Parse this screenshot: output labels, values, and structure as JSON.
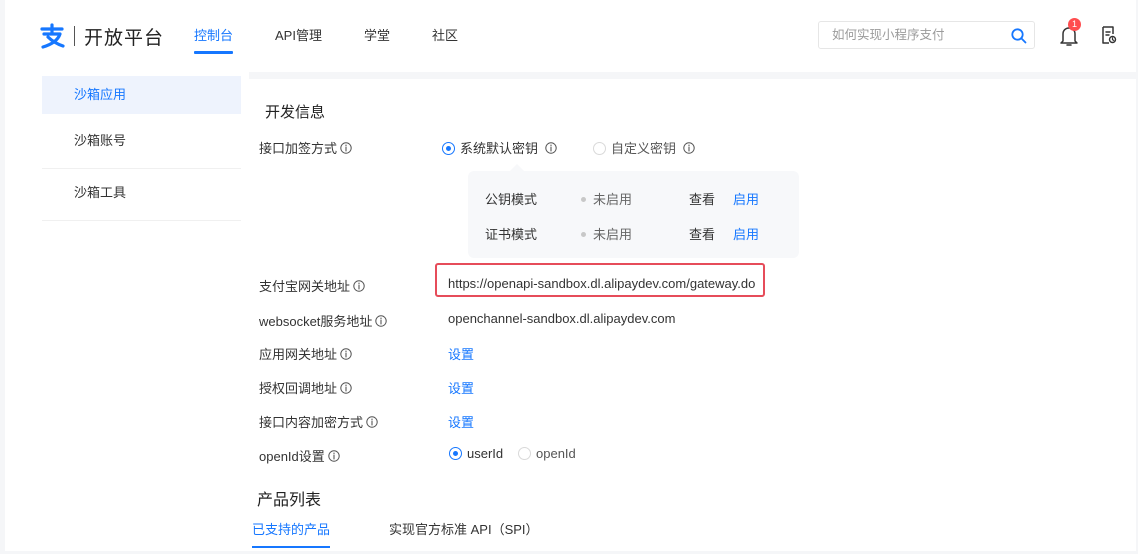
{
  "brand": {
    "title": "开放平台",
    "color": "#1677ff"
  },
  "nav": {
    "items": [
      "控制台",
      "API管理",
      "学堂",
      "社区"
    ],
    "active_index": 0
  },
  "search": {
    "placeholder": "如何实现小程序支付"
  },
  "notifications": {
    "badge": "1"
  },
  "sidebar": {
    "items": [
      "沙箱应用",
      "沙箱账号",
      "沙箱工具"
    ],
    "active_index": 0
  },
  "dev_info": {
    "title": "开发信息",
    "sign_method": {
      "label": "接口加签方式",
      "options": [
        "系统默认密钥",
        "自定义密钥"
      ],
      "selected": "系统默认密钥"
    },
    "key_modes": [
      {
        "name": "公钥模式",
        "status": "未启用",
        "view": "查看",
        "enable": "启用"
      },
      {
        "name": "证书模式",
        "status": "未启用",
        "view": "查看",
        "enable": "启用"
      }
    ],
    "gateway": {
      "label": "支付宝网关地址",
      "value": "https://openapi-sandbox.dl.alipaydev.com/gateway.do"
    },
    "websocket": {
      "label": "websocket服务地址",
      "value": "openchannel-sandbox.dl.alipaydev.com"
    },
    "app_gateway": {
      "label": "应用网关地址",
      "action": "设置"
    },
    "auth_callback": {
      "label": "授权回调地址",
      "action": "设置"
    },
    "content_encrypt": {
      "label": "接口内容加密方式",
      "action": "设置"
    },
    "openid": {
      "label": "openId设置",
      "options": [
        "userId",
        "openId"
      ],
      "selected": "userId"
    }
  },
  "products": {
    "title": "产品列表",
    "tabs": [
      "已支持的产品",
      "实现官方标准 API（SPI）"
    ],
    "active_index": 0
  },
  "colors": {
    "accent": "#1677ff",
    "highlight_border": "#e64c5a",
    "badge": "#ff4d4f"
  }
}
